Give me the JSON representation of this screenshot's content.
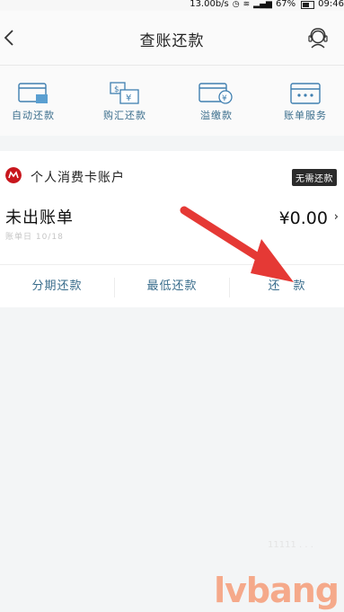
{
  "status_bar": {
    "speed": "13.00b/s",
    "battery": "67%",
    "time": "09:46"
  },
  "header": {
    "title": "查账还款"
  },
  "quick_actions": [
    {
      "label": "自动还款",
      "icon": "card-icon"
    },
    {
      "label": "购汇还款",
      "icon": "exchange-icon"
    },
    {
      "label": "溢缴款",
      "icon": "overpay-icon"
    },
    {
      "label": "账单服务",
      "icon": "bill-service-icon"
    }
  ],
  "account": {
    "name": "个人消费卡账户",
    "badge": "无需还款",
    "bill_status": "未出账单",
    "bill_date": "账单日 10/18",
    "amount": "¥0.00",
    "chevron": "›"
  },
  "actions": [
    {
      "label": "分期还款"
    },
    {
      "label": "最低还款"
    },
    {
      "label": "还　款"
    }
  ],
  "colors": {
    "accent": "#3a6d8c",
    "arrow": "#e53935",
    "logo": "#c8161d"
  },
  "watermark": "lvbang"
}
